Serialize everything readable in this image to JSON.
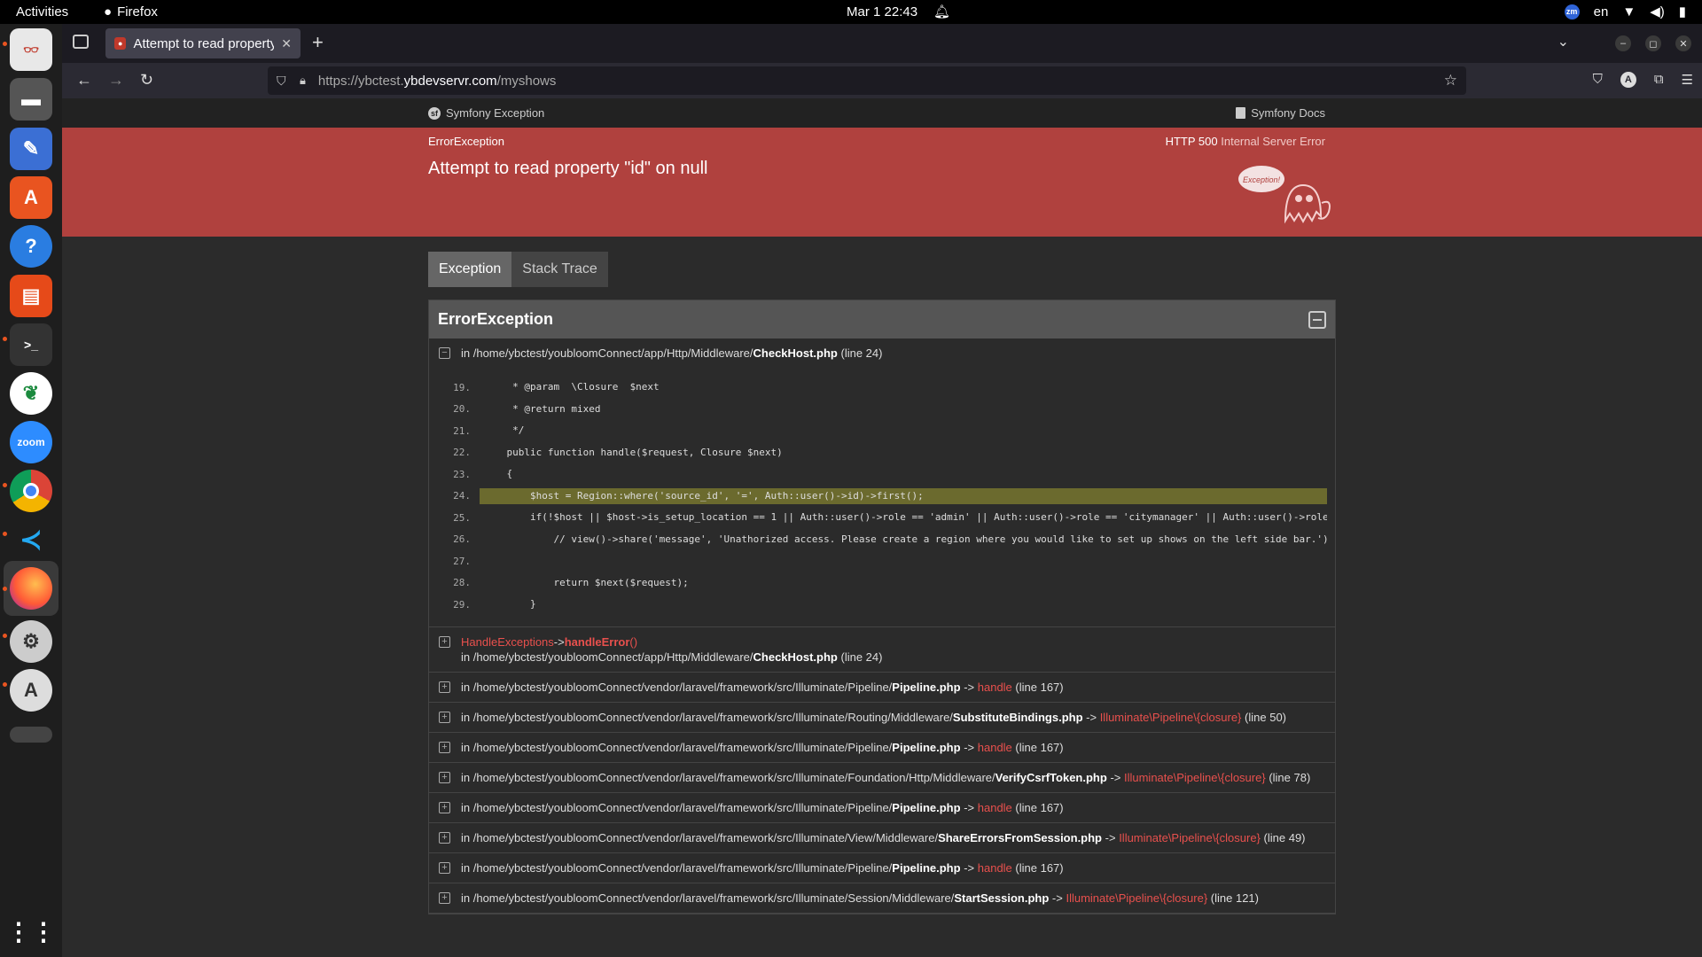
{
  "os": {
    "activities": "Activities",
    "app_name": "Firefox",
    "clock": "Mar 1  22:43",
    "lang": "en",
    "zoom_tray": "zm"
  },
  "dock": {
    "zoom_label": "zoom"
  },
  "browser": {
    "tab_title": "Attempt to read property \"id\" on null",
    "url_prefix": "https://ybctest.",
    "url_domain": "ybdevservr.com",
    "url_path": "/myshows",
    "profile_initial": "A"
  },
  "symfony": {
    "brand": "Symfony Exception",
    "docs": "Symfony Docs",
    "exception_class": "ErrorException",
    "status_code": "HTTP 500",
    "status_text": "Internal Server Error",
    "message": "Attempt to read property \"id\" on null",
    "tabs": [
      "Exception",
      "Stack Trace"
    ],
    "panel_title": "ErrorException",
    "first_trace": {
      "prefix": "in /home/ybctest/youbloomConnect/app/Http/Middleware/",
      "file": "CheckHost.php",
      "line": "(line 24)"
    },
    "code_lines": [
      {
        "n": "19.",
        "text": "     * @param  \\Closure  $next"
      },
      {
        "n": "20.",
        "text": "     * @return mixed"
      },
      {
        "n": "21.",
        "text": "     */"
      },
      {
        "n": "22.",
        "text": "    public function handle($request, Closure $next)"
      },
      {
        "n": "23.",
        "text": "    {"
      },
      {
        "n": "24.",
        "text": "        $host = Region::where('source_id', '=', Auth::user()->id)->first();"
      },
      {
        "n": "25.",
        "text": "        if(!$host || $host->is_setup_location == 1 || Auth::user()->role == 'admin' || Auth::user()->role == 'citymanager' || Auth::user()->role"
      },
      {
        "n": "26.",
        "text": "            // view()->share('message', 'Unathorized access. Please create a region where you would like to set up shows on the left side bar.');"
      },
      {
        "n": "27.",
        "text": ""
      },
      {
        "n": "28.",
        "text": "            return $next($request);"
      },
      {
        "n": "29.",
        "text": "        }"
      }
    ],
    "handle_exceptions": {
      "class": "HandleExceptions",
      "arrow": "->",
      "method": "handleError",
      "parens": "()",
      "prefix": "in /home/ybctest/youbloomConnect/app/Http/Middleware/",
      "file": "CheckHost.php",
      "line": "(line 24)"
    },
    "traces": [
      {
        "prefix": "in /home/ybctest/youbloomConnect/vendor/laravel/framework/src/Illuminate/Pipeline/",
        "file": "Pipeline.php",
        "fn": "handle",
        "line": "(line 167)"
      },
      {
        "prefix": "in /home/ybctest/youbloomConnect/vendor/laravel/framework/src/Illuminate/Routing/Middleware/",
        "file": "SubstituteBindings.php",
        "fn": "Illuminate\\Pipeline\\{closure}",
        "line": "(line 50)"
      },
      {
        "prefix": "in /home/ybctest/youbloomConnect/vendor/laravel/framework/src/Illuminate/Pipeline/",
        "file": "Pipeline.php",
        "fn": "handle",
        "line": "(line 167)"
      },
      {
        "prefix": "in /home/ybctest/youbloomConnect/vendor/laravel/framework/src/Illuminate/Foundation/Http/Middleware/",
        "file": "VerifyCsrfToken.php",
        "fn": "Illuminate\\Pipeline\\{closure}",
        "line": "(line 78)"
      },
      {
        "prefix": "in /home/ybctest/youbloomConnect/vendor/laravel/framework/src/Illuminate/Pipeline/",
        "file": "Pipeline.php",
        "fn": "handle",
        "line": "(line 167)"
      },
      {
        "prefix": "in /home/ybctest/youbloomConnect/vendor/laravel/framework/src/Illuminate/View/Middleware/",
        "file": "ShareErrorsFromSession.php",
        "fn": "Illuminate\\Pipeline\\{closure}",
        "line": "(line 49)"
      },
      {
        "prefix": "in /home/ybctest/youbloomConnect/vendor/laravel/framework/src/Illuminate/Pipeline/",
        "file": "Pipeline.php",
        "fn": "handle",
        "line": "(line 167)"
      },
      {
        "prefix": "in /home/ybctest/youbloomConnect/vendor/laravel/framework/src/Illuminate/Session/Middleware/",
        "file": "StartSession.php",
        "fn": "Illuminate\\Pipeline\\{closure}",
        "line": "(line 121)"
      }
    ],
    "arrow": "->",
    "ghost_label": "Exception!"
  },
  "colors": {
    "banner": "#b0413e",
    "accent_red": "#e8504d",
    "highlight": "#6b6a2e"
  }
}
